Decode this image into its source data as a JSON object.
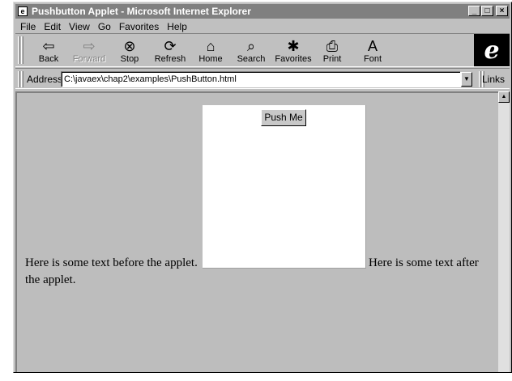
{
  "window": {
    "title": "Pushbutton Applet - Microsoft Internet Explorer",
    "controls": [
      "minimize",
      "maximize",
      "close"
    ]
  },
  "menu": [
    "File",
    "Edit",
    "View",
    "Go",
    "Favorites",
    "Help"
  ],
  "toolbar": {
    "buttons": [
      {
        "label": "Back",
        "icon": "back-arrow-icon",
        "glyph": "⇦",
        "enabled": true
      },
      {
        "label": "Forward",
        "icon": "forward-arrow-icon",
        "glyph": "⇨",
        "enabled": false
      },
      {
        "label": "Stop",
        "icon": "stop-icon",
        "glyph": "⊗",
        "enabled": true
      },
      {
        "label": "Refresh",
        "icon": "refresh-icon",
        "glyph": "⟳",
        "enabled": true
      },
      {
        "label": "Home",
        "icon": "home-icon",
        "glyph": "⌂",
        "enabled": true
      },
      {
        "label": "Search",
        "icon": "search-icon",
        "glyph": "⌕",
        "enabled": true
      },
      {
        "label": "Favorites",
        "icon": "favorites-icon",
        "glyph": "✱",
        "enabled": true
      },
      {
        "label": "Print",
        "icon": "print-icon",
        "glyph": "⎙",
        "enabled": true
      },
      {
        "label": "Font",
        "icon": "font-icon",
        "glyph": "A",
        "enabled": true
      }
    ],
    "logo": "e"
  },
  "address": {
    "label": "Address",
    "value": "C:\\javaex\\chap2\\examples\\PushButton.html",
    "links_label": "Links"
  },
  "page": {
    "text_before": "Here is some text before the applet.",
    "text_after_1": "Here is some text after",
    "text_after_2": "the applet.",
    "applet": {
      "button_label": "Push Me"
    }
  }
}
